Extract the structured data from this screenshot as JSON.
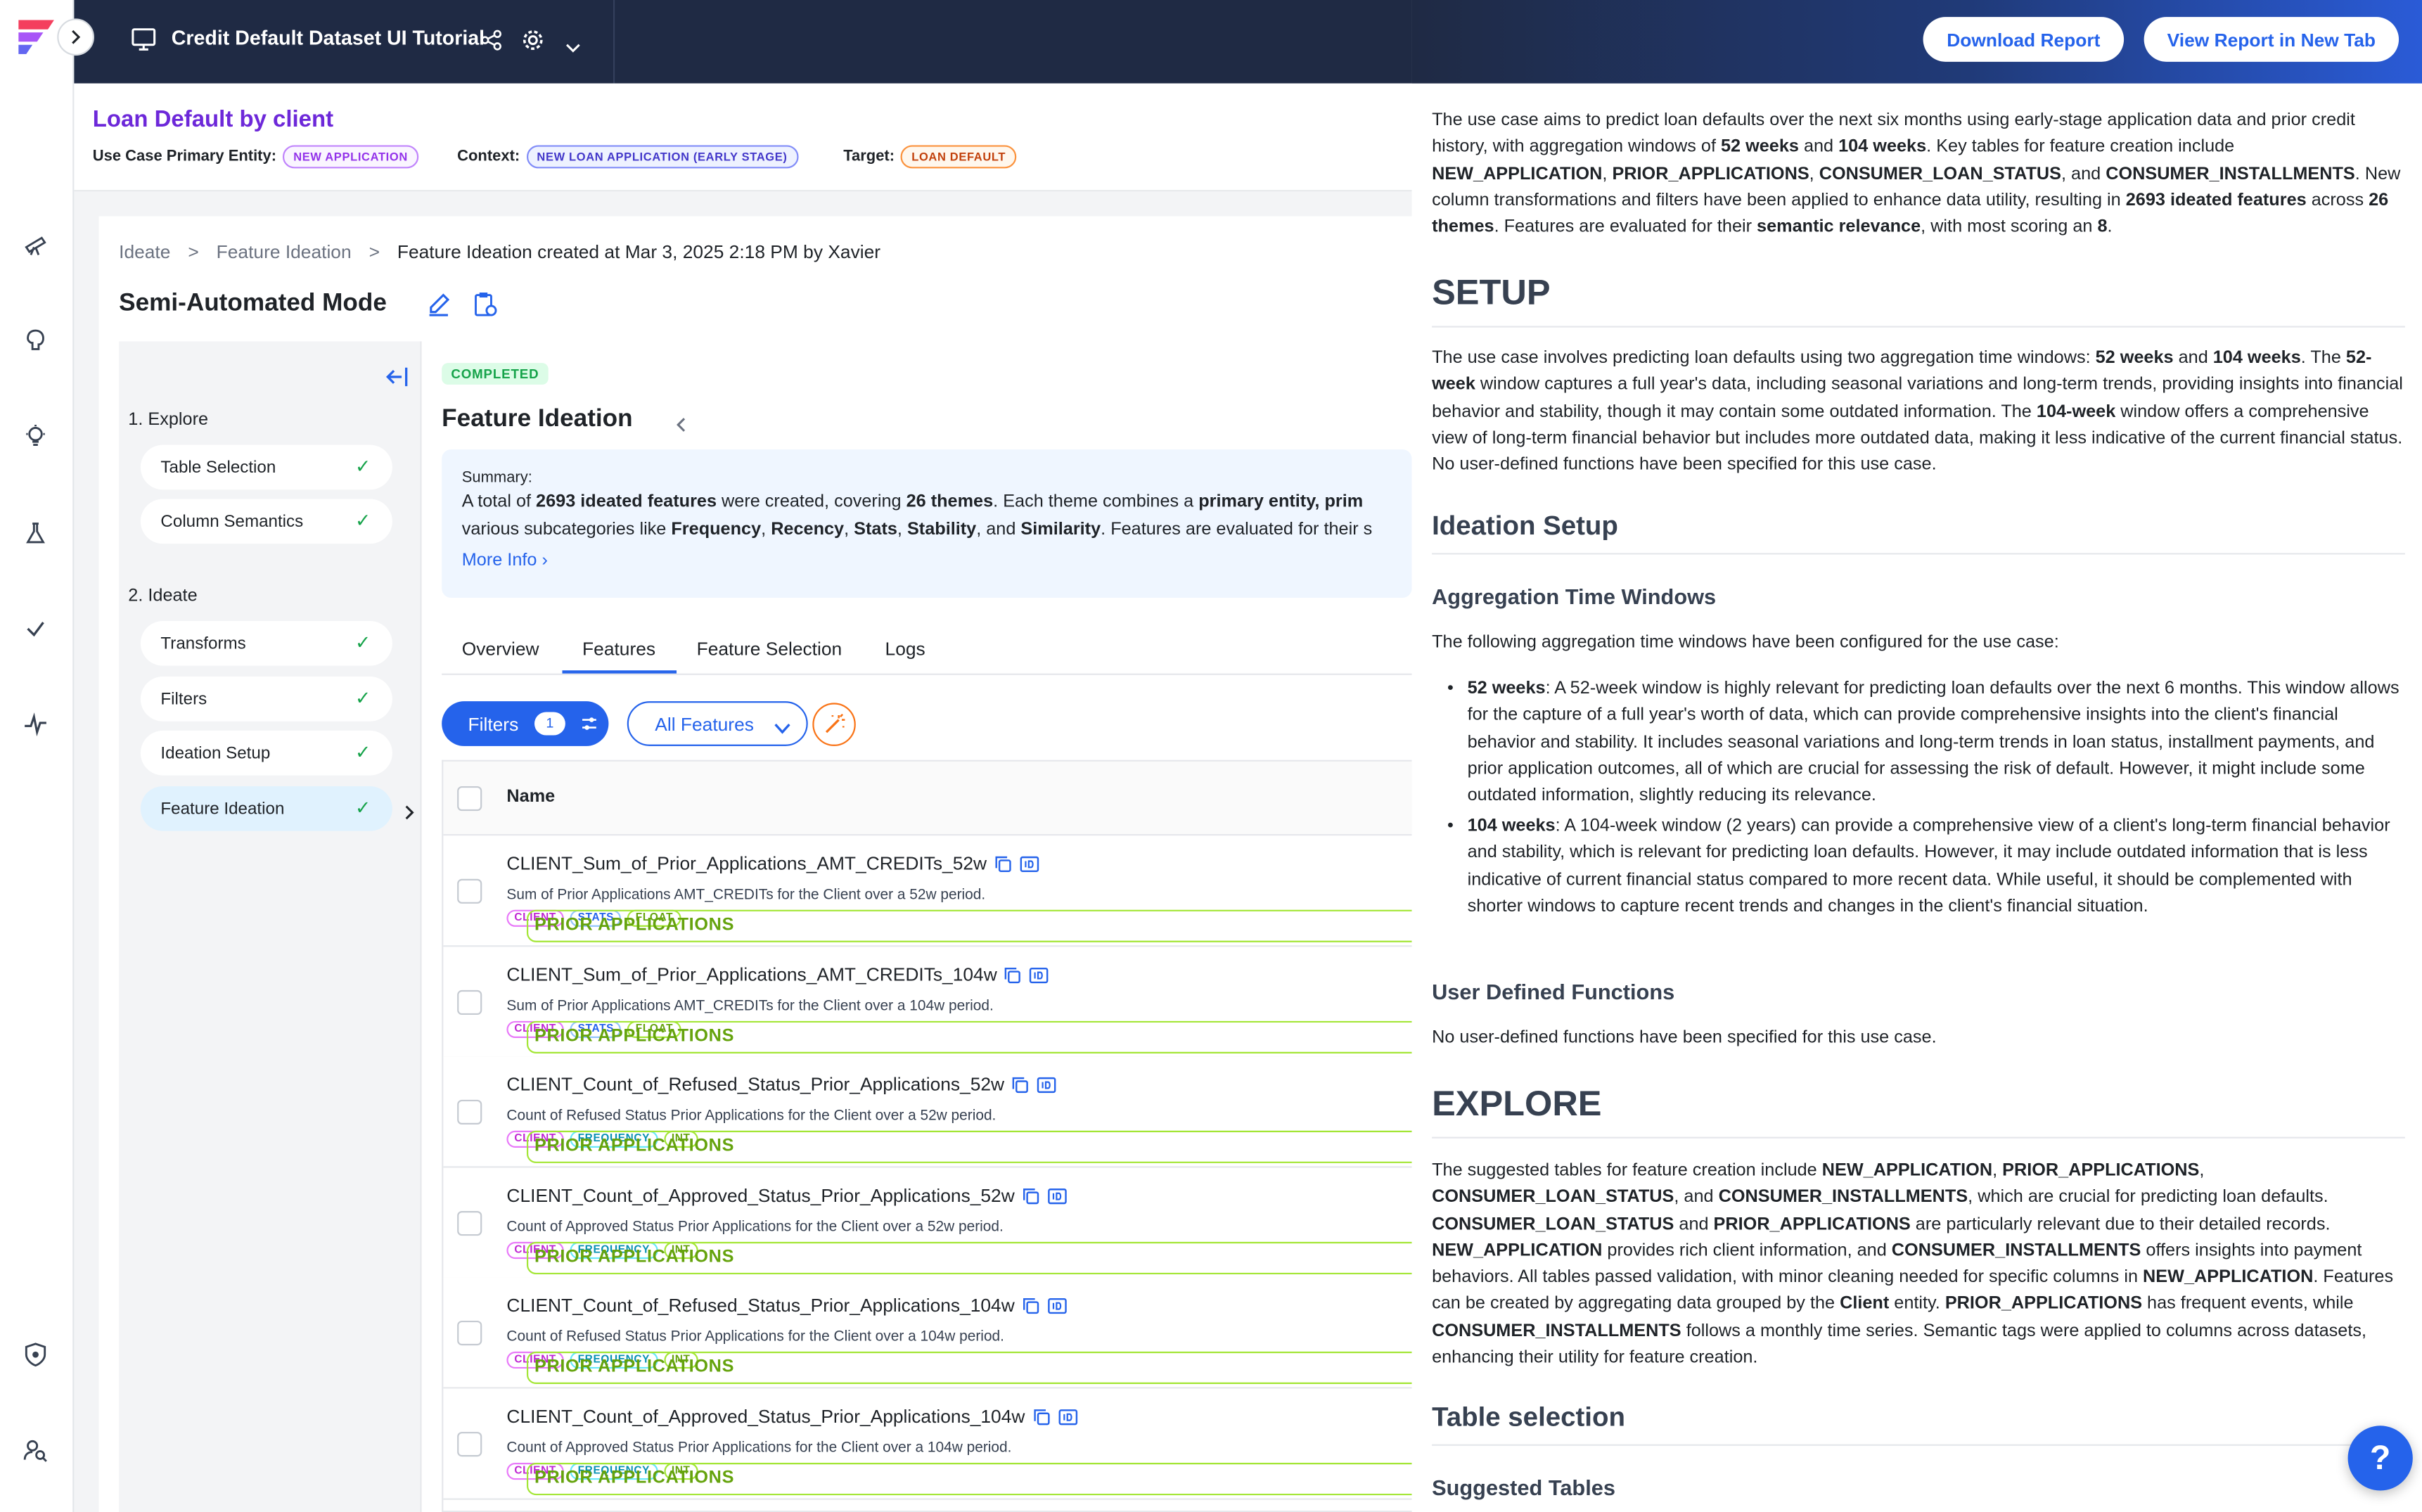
{
  "topbar": {
    "title": "Credit Default Dataset UI Tutorial"
  },
  "page": {
    "title": "Loan Default by client",
    "primary_entity_label": "Use Case Primary Entity:",
    "primary_entity": "NEW APPLICATION",
    "context_label": "Context:",
    "context": "NEW LOAN APPLICATION (EARLY STAGE)",
    "target_label": "Target:",
    "target": "LOAN DEFAULT"
  },
  "breadcrumb": {
    "items": [
      "Ideate",
      "Feature Ideation"
    ],
    "current": "Feature Ideation created at Mar 3, 2025 2:18 PM by Xavier"
  },
  "mode": "Semi-Automated Mode",
  "stepper": {
    "explore_heading": "1. Explore",
    "explore_items": [
      "Table Selection",
      "Column Semantics"
    ],
    "ideate_heading": "2. Ideate",
    "ideate_items": [
      "Transforms",
      "Filters",
      "Ideation Setup",
      "Feature Ideation"
    ]
  },
  "status": "COMPLETED",
  "panel_title": "Feature Ideation",
  "summary": {
    "label": "Summary:",
    "line1_a": "A total of ",
    "line1_b": "2693 ideated features",
    "line1_c": " were created, covering ",
    "line1_d": "26 themes",
    "line1_e": ". Each theme combines a ",
    "line1_f": "primary entity",
    "line1_g": ", prim",
    "line2_a": "various subcategories like ",
    "line2_b": "Frequency",
    "line2_c": ", ",
    "line2_d": "Recency",
    "line2_e": ", ",
    "line2_f": "Stats",
    "line2_g": ", ",
    "line2_h": "Stability",
    "line2_i": ", and ",
    "line2_j": "Similarity",
    "line2_k": ". Features are evaluated for their s",
    "more_info": "More Info"
  },
  "tabs": [
    "Overview",
    "Features",
    "Feature Selection",
    "Logs"
  ],
  "toolbar": {
    "filters_label": "Filters",
    "filters_count": "1",
    "all_features": "All Features"
  },
  "table": {
    "header_name": "Name",
    "rows": [
      {
        "name": "CLIENT_Sum_of_Prior_Applications_AMT_CREDITs_52w",
        "desc": "Sum of Prior Applications AMT_CREDITs for the Client over a 52w period.",
        "tags": [
          "CLIENT",
          "PRIOR APPLICATIONS",
          "STATS",
          "FLOAT"
        ]
      },
      {
        "name": "CLIENT_Sum_of_Prior_Applications_AMT_CREDITs_104w",
        "desc": "Sum of Prior Applications AMT_CREDITs for the Client over a 104w period.",
        "tags": [
          "CLIENT",
          "PRIOR APPLICATIONS",
          "STATS",
          "FLOAT"
        ]
      },
      {
        "name": "CLIENT_Count_of_Refused_Status_Prior_Applications_52w",
        "desc": "Count of Refused Status Prior Applications for the Client over a 52w period.",
        "tags": [
          "CLIENT",
          "PRIOR APPLICATIONS",
          "FREQUENCY",
          "INT"
        ]
      },
      {
        "name": "CLIENT_Count_of_Approved_Status_Prior_Applications_52w",
        "desc": "Count of Approved Status Prior Applications for the Client over a 52w period.",
        "tags": [
          "CLIENT",
          "PRIOR APPLICATIONS",
          "FREQUENCY",
          "INT"
        ]
      },
      {
        "name": "CLIENT_Count_of_Refused_Status_Prior_Applications_104w",
        "desc": "Count of Refused Status Prior Applications for the Client over a 104w period.",
        "tags": [
          "CLIENT",
          "PRIOR APPLICATIONS",
          "FREQUENCY",
          "INT"
        ]
      },
      {
        "name": "CLIENT_Count_of_Approved_Status_Prior_Applications_104w",
        "desc": "Count of Approved Status Prior Applications for the Client over a 104w period.",
        "tags": [
          "CLIENT",
          "PRIOR APPLICATIONS",
          "FREQUENCY",
          "INT"
        ]
      }
    ]
  },
  "report": {
    "download_label": "Download Report",
    "view_label": "View Report in New Tab",
    "intro": "The use case aims to predict loan defaults over the next six months using early-stage application data and prior credit history, with aggregation windows of <b>52 weeks</b> and <b>104 weeks</b>. Key tables for feature creation include <b>NEW_APPLICATION</b>, <b>PRIOR_APPLICATIONS</b>, <b>CONSUMER_LOAN_STATUS</b>, and <b>CONSUMER_INSTALLMENTS</b>. New column transformations and filters have been applied to enhance data utility, resulting in <b>2693 ideated features</b> across <b>26 themes</b>. Features are evaluated for their <b>semantic relevance</b>, with most scoring an <b>8</b>.",
    "setup_heading": "SETUP",
    "setup_text": "The use case involves predicting loan defaults using two aggregation time windows: <b>52 weeks</b> and <b>104 weeks</b>. The <b>52-week</b> window captures a full year's data, including seasonal variations and long-term trends, providing insights into financial behavior and stability, though it may contain some outdated information. The <b>104-week</b> window offers a comprehensive view of long-term financial behavior but includes more outdated data, making it less indicative of the current financial status. No user-defined functions have been specified for this use case.",
    "ideation_setup_heading": "Ideation Setup",
    "agg_heading": "Aggregation Time Windows",
    "agg_text": "The following aggregation time windows have been configured for the use case:",
    "bullet1": "<b>52 weeks</b>: A 52-week window is highly relevant for predicting loan defaults over the next 6 months. This window allows for the capture of a full year's worth of data, which can provide comprehensive insights into the client's financial behavior and stability. It includes seasonal variations and long-term trends in loan status, installment payments, and prior application outcomes, all of which are crucial for assessing the risk of default. However, it might include some outdated information, slightly reducing its relevance.",
    "bullet2": "<b>104 weeks</b>: A 104-week window (2 years) can provide a comprehensive view of a client's long-term financial behavior and stability, which is relevant for predicting loan defaults. However, it may include outdated information that is less indicative of current financial status compared to more recent data. While useful, it should be complemented with shorter windows to capture recent trends and changes in the client's financial situation.",
    "udf_heading": "User Defined Functions",
    "udf_text": "No user-defined functions have been specified for this use case.",
    "explore_heading": "EXPLORE",
    "explore_text": "The suggested tables for feature creation include <b>NEW_APPLICATION</b>, <b>PRIOR_APPLICATIONS</b>, <b>CONSUMER_LOAN_STATUS</b>, and <b>CONSUMER_INSTALLMENTS</b>, which are crucial for predicting loan defaults. <b>CONSUMER_LOAN_STATUS</b> and <b>PRIOR_APPLICATIONS</b> are particularly relevant due to their detailed records. <b>NEW_APPLICATION</b> provides rich client information, and <b>CONSUMER_INSTALLMENTS</b> offers insights into payment behaviors. All tables passed validation, with minor cleaning needed for specific columns in <b>NEW_APPLICATION</b>. Features can be created by aggregating data grouped by the <b>Client</b> entity. <b>PRIOR_APPLICATIONS</b> has frequent events, while <b>CONSUMER_INSTALLMENTS</b> follows a monthly time series. Semantic tags were applied to columns across datasets, enhancing their utility for feature creation.",
    "table_selection_heading": "Table selection",
    "suggested_tables_heading": "Suggested Tables"
  },
  "help_label": "?"
}
